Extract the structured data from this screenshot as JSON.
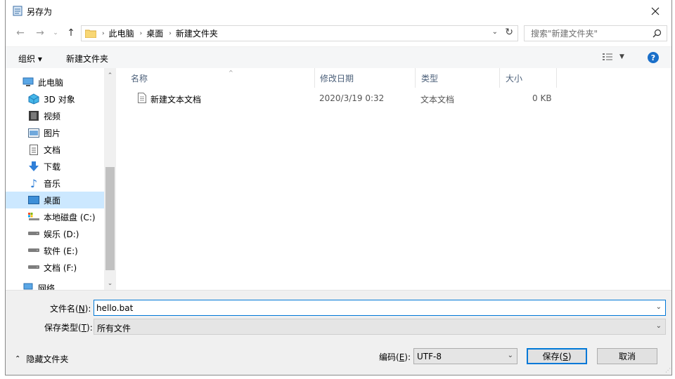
{
  "window": {
    "title": "另存为",
    "close_label": "✕"
  },
  "address": {
    "crumbs": [
      "此电脑",
      "桌面",
      "新建文件夹"
    ],
    "separator": "›"
  },
  "search": {
    "placeholder": "搜索\"新建文件夹\""
  },
  "toolbar": {
    "organize_label": "组织 ▾",
    "new_folder_label": "新建文件夹",
    "help_label": "?"
  },
  "sidebar": {
    "items": [
      {
        "label": "此电脑",
        "icon": "computer-icon"
      },
      {
        "label": "3D 对象",
        "icon": "3d-objects-icon"
      },
      {
        "label": "视频",
        "icon": "video-icon"
      },
      {
        "label": "图片",
        "icon": "pictures-icon"
      },
      {
        "label": "文档",
        "icon": "documents-icon"
      },
      {
        "label": "下载",
        "icon": "download-icon"
      },
      {
        "label": "音乐",
        "icon": "music-icon"
      },
      {
        "label": "桌面",
        "icon": "desktop-icon",
        "selected": true
      },
      {
        "label": "本地磁盘 (C:)",
        "icon": "local-disk-icon"
      },
      {
        "label": "娱乐 (D:)",
        "icon": "drive-icon"
      },
      {
        "label": "软件 (E:)",
        "icon": "drive-icon"
      },
      {
        "label": "文档 (F:)",
        "icon": "drive-icon"
      },
      {
        "label": "网络",
        "icon": "network-icon"
      }
    ]
  },
  "file_list": {
    "columns": [
      "名称",
      "修改日期",
      "类型",
      "大小"
    ],
    "rows": [
      {
        "name": "新建文本文档",
        "modified": "2020/3/19 0:32",
        "type": "文本文档",
        "size": "0 KB"
      }
    ]
  },
  "form": {
    "filename_label": "文件名(",
    "filename_key": "N",
    "filename_label_end": "):",
    "filename_value": "hello.bat",
    "filetype_label": "保存类型(",
    "filetype_key": "T",
    "filetype_label_end": "):",
    "filetype_value": "所有文件",
    "hide_folders_label": "隐藏文件夹",
    "encoding_label": "编码(",
    "encoding_key": "E",
    "encoding_label_end": "):",
    "encoding_value": "UTF-8",
    "save_label": "保存(",
    "save_key": "S",
    "save_label_end": ")",
    "cancel_label": "取消"
  },
  "colors": {
    "accent": "#0078d7",
    "selection": "#cce8ff",
    "header_text": "#4c607a"
  }
}
